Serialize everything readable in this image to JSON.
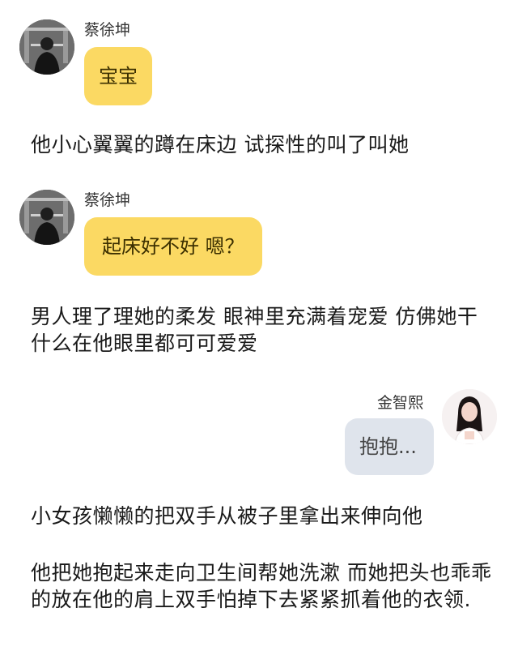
{
  "messages": [
    {
      "sender": "蔡徐坤",
      "text": "宝宝",
      "side": "left",
      "bubble_color": "#fbd963"
    },
    {
      "sender": "蔡徐坤",
      "text": "起床好不好 嗯？",
      "side": "left",
      "bubble_color": "#fbd963"
    },
    {
      "sender": "金智熙",
      "text": "抱抱...",
      "side": "right",
      "bubble_color": "#dfe4ec"
    }
  ],
  "narration": [
    "他小心翼翼的蹲在床边 试探性的叫了叫她",
    "男人理了理她的柔发 眼神里充满着宠爱 仿佛她干什么在他眼里都可可爱爱",
    "小女孩懒懒的把双手从被子里拿出来伸向他",
    "他把她抱起来走向卫生间帮她洗漱 而她把头也乖乖的放在他的肩上双手怕掉下去紧紧抓着他的衣领."
  ]
}
